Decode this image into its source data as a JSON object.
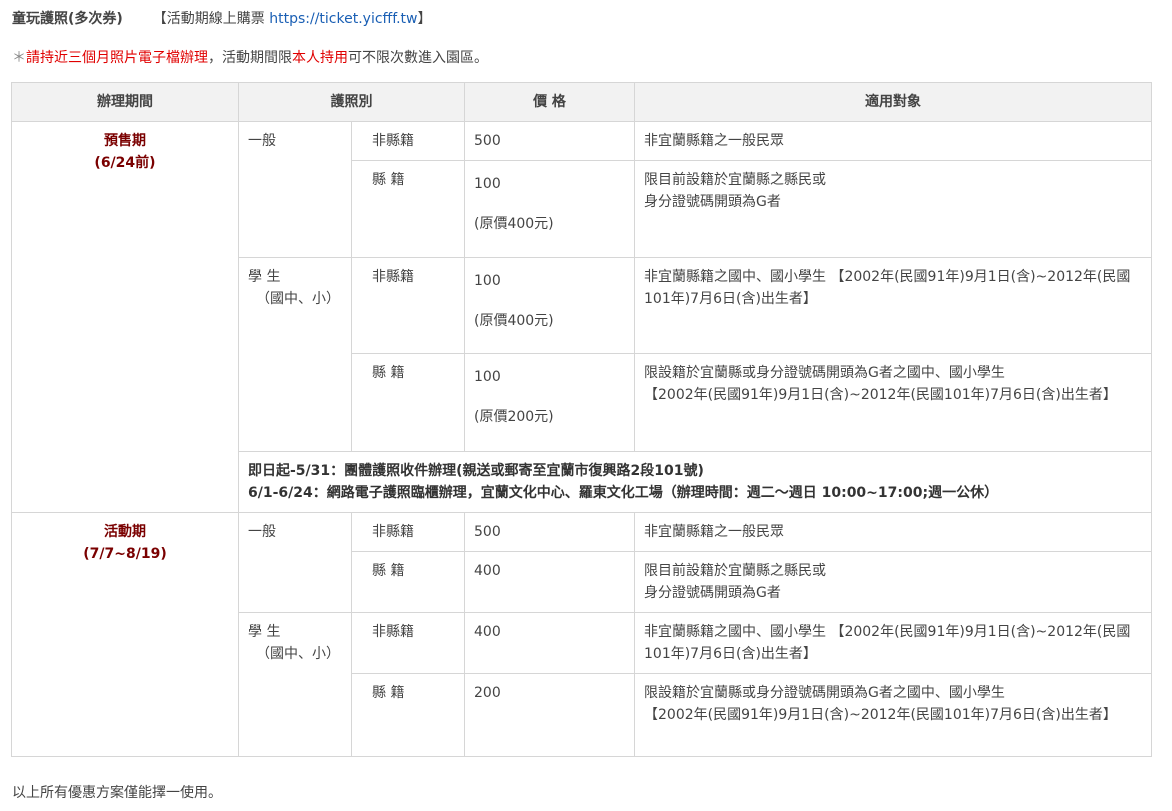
{
  "header": {
    "title": "童玩護照(多次券)",
    "online_label": "【活動期線上購票 ",
    "online_url": "https://ticket.yicfff.tw",
    "online_end": "】"
  },
  "note": {
    "star": "＊",
    "red1": "請持近三個月照片電子檔辦理",
    "mid": "，活動期間限",
    "red2": "本人持用",
    "end": "可不限次數進入園區。"
  },
  "table": {
    "headers": [
      "辦理期間",
      "護照別",
      "價 格",
      "適用對象"
    ],
    "presale": {
      "period": "預售期",
      "range": "(6/24前)",
      "general": "一般",
      "student": "學 生",
      "student_sub": "（國中、小）",
      "rows": [
        {
          "cat": "非縣籍",
          "price": "500",
          "orig": "",
          "target": "非宜蘭縣籍之一般民眾"
        },
        {
          "cat": "縣 籍",
          "price": "100",
          "orig": "(原價400元)",
          "target": "限目前設籍於宜蘭縣之縣民或\n身分證號碼開頭為G者"
        },
        {
          "cat": "非縣籍",
          "price": "100",
          "orig": "(原價400元)",
          "target": "非宜蘭縣籍之國中、國小學生 【2002年(民國91年)9月1日(含)~2012年(民國101年)7月6日(含)出生者】"
        },
        {
          "cat": "縣 籍",
          "price": "100",
          "orig": "(原價200元)",
          "target": "限設籍於宜蘭縣或身分證號碼開頭為G者之國中、國小學生\n【2002年(民國91年)9月1日(含)~2012年(民國101年)7月6日(含)出生者】"
        }
      ],
      "ship_line1": "即日起-5/31：團體護照收件辦理(親送或郵寄至宜蘭市復興路2段101號)",
      "ship_line2": "6/1-6/24：網路電子護照臨櫃辦理，宜蘭文化中心、羅東文化工場（辦理時間：週二～週日 10:00~17:00;週一公休）"
    },
    "event": {
      "period": "活動期",
      "range": "(7/7~8/19)",
      "general": "一般",
      "student": "學 生",
      "student_sub": "（國中、小）",
      "rows": [
        {
          "cat": "非縣籍",
          "price": "500",
          "target": "非宜蘭縣籍之一般民眾"
        },
        {
          "cat": "縣 籍",
          "price": "400",
          "target": "限目前設籍於宜蘭縣之縣民或\n身分證號碼開頭為G者"
        },
        {
          "cat": "非縣籍",
          "price": "400",
          "target": "非宜蘭縣籍之國中、國小學生 【2002年(民國91年)9月1日(含)~2012年(民國101年)7月6日(含)出生者】"
        },
        {
          "cat": "縣 籍",
          "price": "200",
          "target": "限設籍於宜蘭縣或身分證號碼開頭為G者之國中、國小學生\n【2002年(民國91年)9月1日(含)~2012年(民國101年)7月6日(含)出生者】"
        }
      ]
    }
  },
  "footer": {
    "note": "以上所有優惠方案僅能擇一使用。"
  }
}
